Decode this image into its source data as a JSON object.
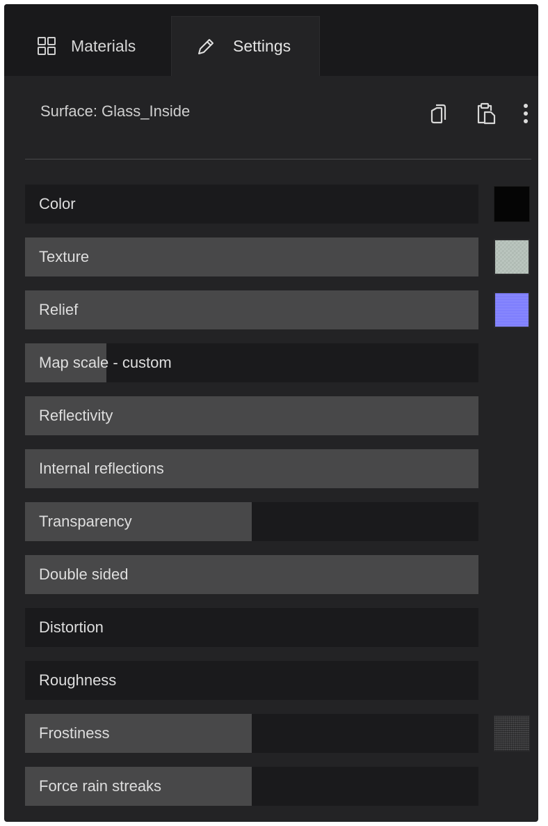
{
  "tabs": {
    "materials": {
      "label": "Materials",
      "icon": "grid-icon"
    },
    "settings": {
      "label": "Settings",
      "icon": "pencil-icon",
      "active": true
    }
  },
  "header": {
    "surface_title": "Surface: Glass_Inside",
    "copy_icon": "copy-icon",
    "paste_icon": "paste-icon",
    "more_icon": "more-vertical-icon"
  },
  "properties": [
    {
      "label": "Color",
      "fill": 0,
      "swatch": "#050505"
    },
    {
      "label": "Texture",
      "fill": 1
    },
    {
      "label": "Relief",
      "fill": 1,
      "swatch": "#7f7ffd"
    },
    {
      "label": "Map scale - custom",
      "fill": 0.18
    },
    {
      "label": "Reflectivity",
      "fill": 1
    },
    {
      "label": "Internal reflections",
      "fill": 1
    },
    {
      "label": "Transparency",
      "fill": 0.5
    },
    {
      "label": "Double sided",
      "fill": 1
    },
    {
      "label": "Distortion",
      "fill": 0
    },
    {
      "label": "Roughness",
      "fill": 0
    },
    {
      "label": "Frostiness",
      "fill": 0.5
    },
    {
      "label": "Force rain streaks",
      "fill": 0.5
    }
  ],
  "colors": {
    "panel_bg": "#232325",
    "tabbar_bg": "#19191b",
    "row_bg": "#1a1a1c",
    "row_fill": "#484849",
    "text": "#dedede"
  }
}
